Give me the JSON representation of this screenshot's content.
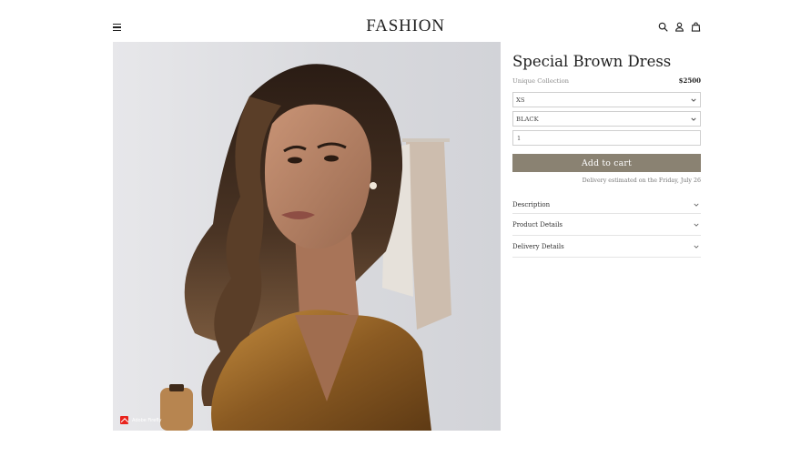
{
  "header": {
    "brand": "FASHION",
    "icons": [
      "menu-icon",
      "search-icon",
      "user-icon",
      "bag-icon"
    ]
  },
  "product_image": {
    "badge": "Adobe Firefly"
  },
  "product": {
    "title": "Special Brown Dress",
    "collection": "Unique Collection",
    "price": "$2500",
    "size_selected": "XS",
    "color_selected": "BLACK",
    "quantity": "1",
    "add_to_cart_label": "Add to cart",
    "delivery_note": "Delivery estimated on the Friday, July 26"
  },
  "accordion": [
    {
      "label": "Description"
    },
    {
      "label": "Product Details"
    },
    {
      "label": "Delivery Details"
    }
  ],
  "colors": {
    "button": "#8a8272",
    "border": "#cfcfcf",
    "firefly": "#e8231d"
  }
}
